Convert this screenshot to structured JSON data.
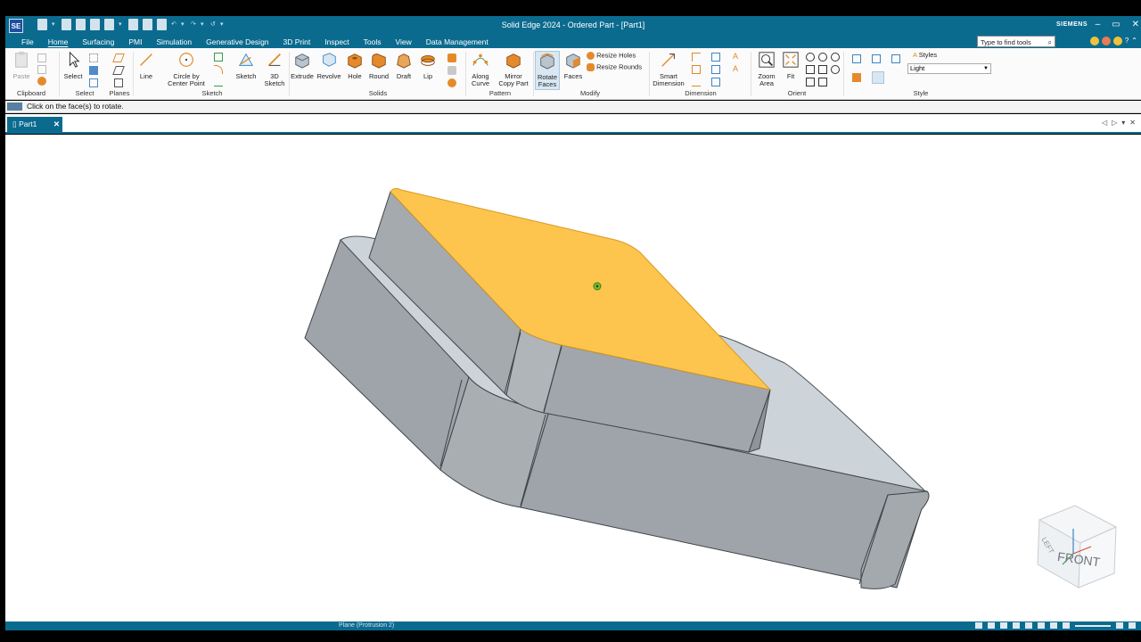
{
  "window": {
    "app_logo": "SE",
    "title": "Solid Edge 2024 - Ordered Part - [Part1]",
    "brand": "SIEMENS"
  },
  "menu": {
    "tabs": [
      "File",
      "Home",
      "Surfacing",
      "PMI",
      "Simulation",
      "Generative Design",
      "3D Print",
      "Inspect",
      "Tools",
      "View",
      "Data Management"
    ],
    "active_tab": "Home",
    "search_placeholder": "Type to find tools"
  },
  "ribbon": {
    "clipboard": {
      "label": "Clipboard",
      "paste": "Paste"
    },
    "select": {
      "label": "Select",
      "select": "Select"
    },
    "planes": {
      "label": "Planes"
    },
    "sketch": {
      "label": "Sketch",
      "line": "Line",
      "circle1": "Circle by",
      "circle2": "Center Point",
      "sketch": "Sketch",
      "sketch3d1": "3D",
      "sketch3d2": "Sketch"
    },
    "solids": {
      "label": "Solids",
      "extrude": "Extrude",
      "revolve": "Revolve",
      "hole": "Hole",
      "round": "Round",
      "draft": "Draft",
      "lip": "Lip"
    },
    "pattern": {
      "label": "Pattern",
      "along1": "Along",
      "along2": "Curve",
      "mirror1": "Mirror",
      "mirror2": "Copy Part"
    },
    "modify": {
      "label": "Modify",
      "rotate1": "Rotate",
      "rotate2": "Faces",
      "faces": "Faces",
      "resize_holes": "Resize Holes",
      "resize_rounds": "Resize Rounds"
    },
    "dimension": {
      "label": "Dimension",
      "smart1": "Smart",
      "smart2": "Dimension"
    },
    "orient": {
      "label": "Orient",
      "zoom1": "Zoom",
      "zoom2": "Area",
      "fit": "Fit"
    },
    "style": {
      "label": "Style",
      "styles": "Styles",
      "current": "Light"
    }
  },
  "prompt": {
    "text": "Click on the face(s) to rotate."
  },
  "document": {
    "tab": "Part1"
  },
  "viewcube": {
    "face_label": "FRONT",
    "top_label": "LEFT"
  },
  "status": {
    "text": "Plane (Protrusion 2)"
  },
  "colors": {
    "accent": "#0b6b8f",
    "selected_face": "#fdc54e",
    "part_body": "#9aa1a7",
    "part_top": "#cfd6dc"
  }
}
